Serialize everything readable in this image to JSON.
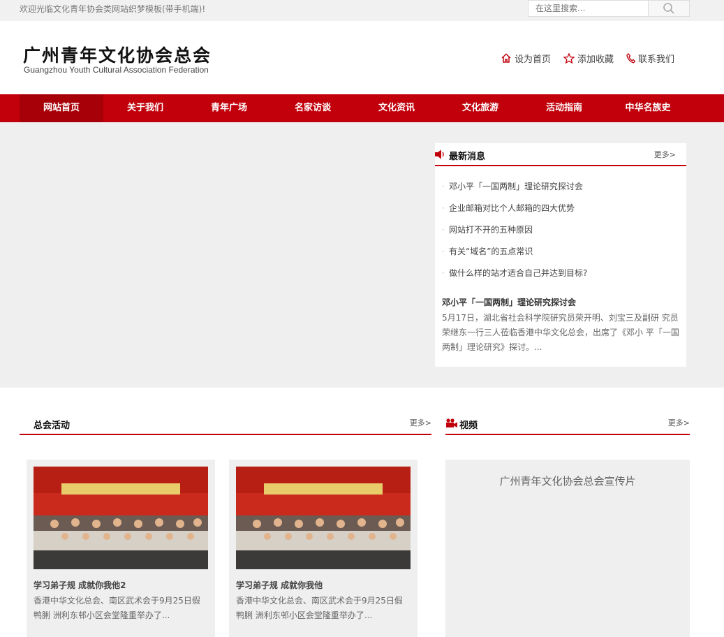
{
  "topbar": {
    "welcome": "欢迎光临文化青年协会类网站织梦模板(带手机端)!",
    "search_placeholder": "在这里搜索..."
  },
  "header": {
    "logo_cn": "广州青年文化协会总会",
    "logo_en": "Guangzhou Youth Cultural Association Federation",
    "links": [
      "设为首页",
      "添加收藏",
      "联系我们"
    ]
  },
  "nav": [
    "网站首页",
    "关于我们",
    "青年广场",
    "名家访谈",
    "文化资讯",
    "文化旅游",
    "活动指南",
    "中华名族史"
  ],
  "news": {
    "title": "最新消息",
    "more": "更多>",
    "items": [
      "邓小平「一国两制」理论研究探讨会",
      "企业邮箱对比个人邮箱的四大优势",
      "网站打不开的五种原因",
      "有关“域名”的五点常识",
      "做什么样的站才适合自己并达到目标?"
    ],
    "featured_title": "邓小平「一国两制」理论研究探讨会",
    "featured_desc": "5月17日，湖北省社会科学院研究员荣开明、刘宝三及副研 究员荣继东一行三人莅临香港中华文化总会，出席了《邓小 平「一国两制」理论研究》探讨。..."
  },
  "activities": {
    "title": "总会活动",
    "more": "更多>",
    "cards": [
      {
        "title": "学习弟子规 成就你我他2",
        "desc": "香港中华文化总会、南区武术会于9月25日假鸭脷 洲利东邨小区会堂隆重举办了..."
      },
      {
        "title": "学习弟子规 成就你我他",
        "desc": "香港中华文化总会、南区武术会于9月25日假鸭脷 洲利东邨小区会堂隆重举办了..."
      }
    ]
  },
  "video": {
    "title": "视频",
    "more": "更多>",
    "caption": "广州青年文化协会总会宣传片"
  },
  "colors": {
    "brand_red": "#c1000b",
    "band_gray": "#efefef"
  }
}
